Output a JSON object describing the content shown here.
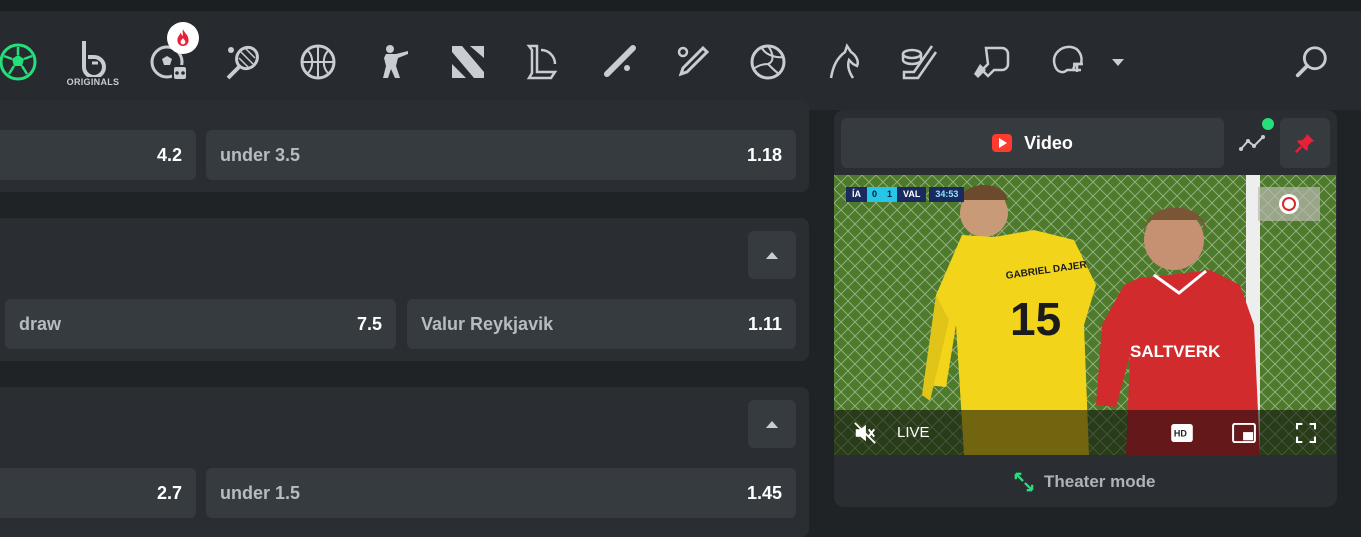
{
  "nav": {
    "originals_label": "ORIGINALS",
    "icons": [
      "soccer-icon",
      "originals-logo-icon",
      "hot-soccer-bot-icon",
      "tennis-icon",
      "basketball-icon",
      "counter-strike-icon",
      "dota-icon",
      "league-of-legends-icon",
      "baseball-icon",
      "cricket-icon",
      "volleyball-icon",
      "horse-racing-icon",
      "ice-hockey-icon",
      "table-tennis-icon",
      "american-football-icon"
    ],
    "active_color": "#24e07a"
  },
  "markets": [
    {
      "options": [
        {
          "label": "",
          "odds": "4.2"
        },
        {
          "label": "under 3.5",
          "odds": "1.18"
        }
      ]
    },
    {
      "options": [
        {
          "label": "draw",
          "odds": "7.5"
        },
        {
          "label": "Valur Reykjavik",
          "odds": "1.11"
        }
      ]
    },
    {
      "options": [
        {
          "label": "",
          "odds": "2.7"
        },
        {
          "label": "under 1.5",
          "odds": "1.45"
        }
      ]
    }
  ],
  "side": {
    "video_tab": "Video",
    "live_label": "LIVE",
    "theater_mode": "Theater mode",
    "scorebug": {
      "home": "ÍA",
      "home_score": "0",
      "away_score": "1",
      "away": "VAL",
      "clock": "34:53"
    },
    "player_name": "GABRIEL DAJER",
    "player_number": "15",
    "sponsor": "SALTVERK",
    "pin_color": "#e8213a",
    "video_icon_color": "#ff3b30"
  }
}
